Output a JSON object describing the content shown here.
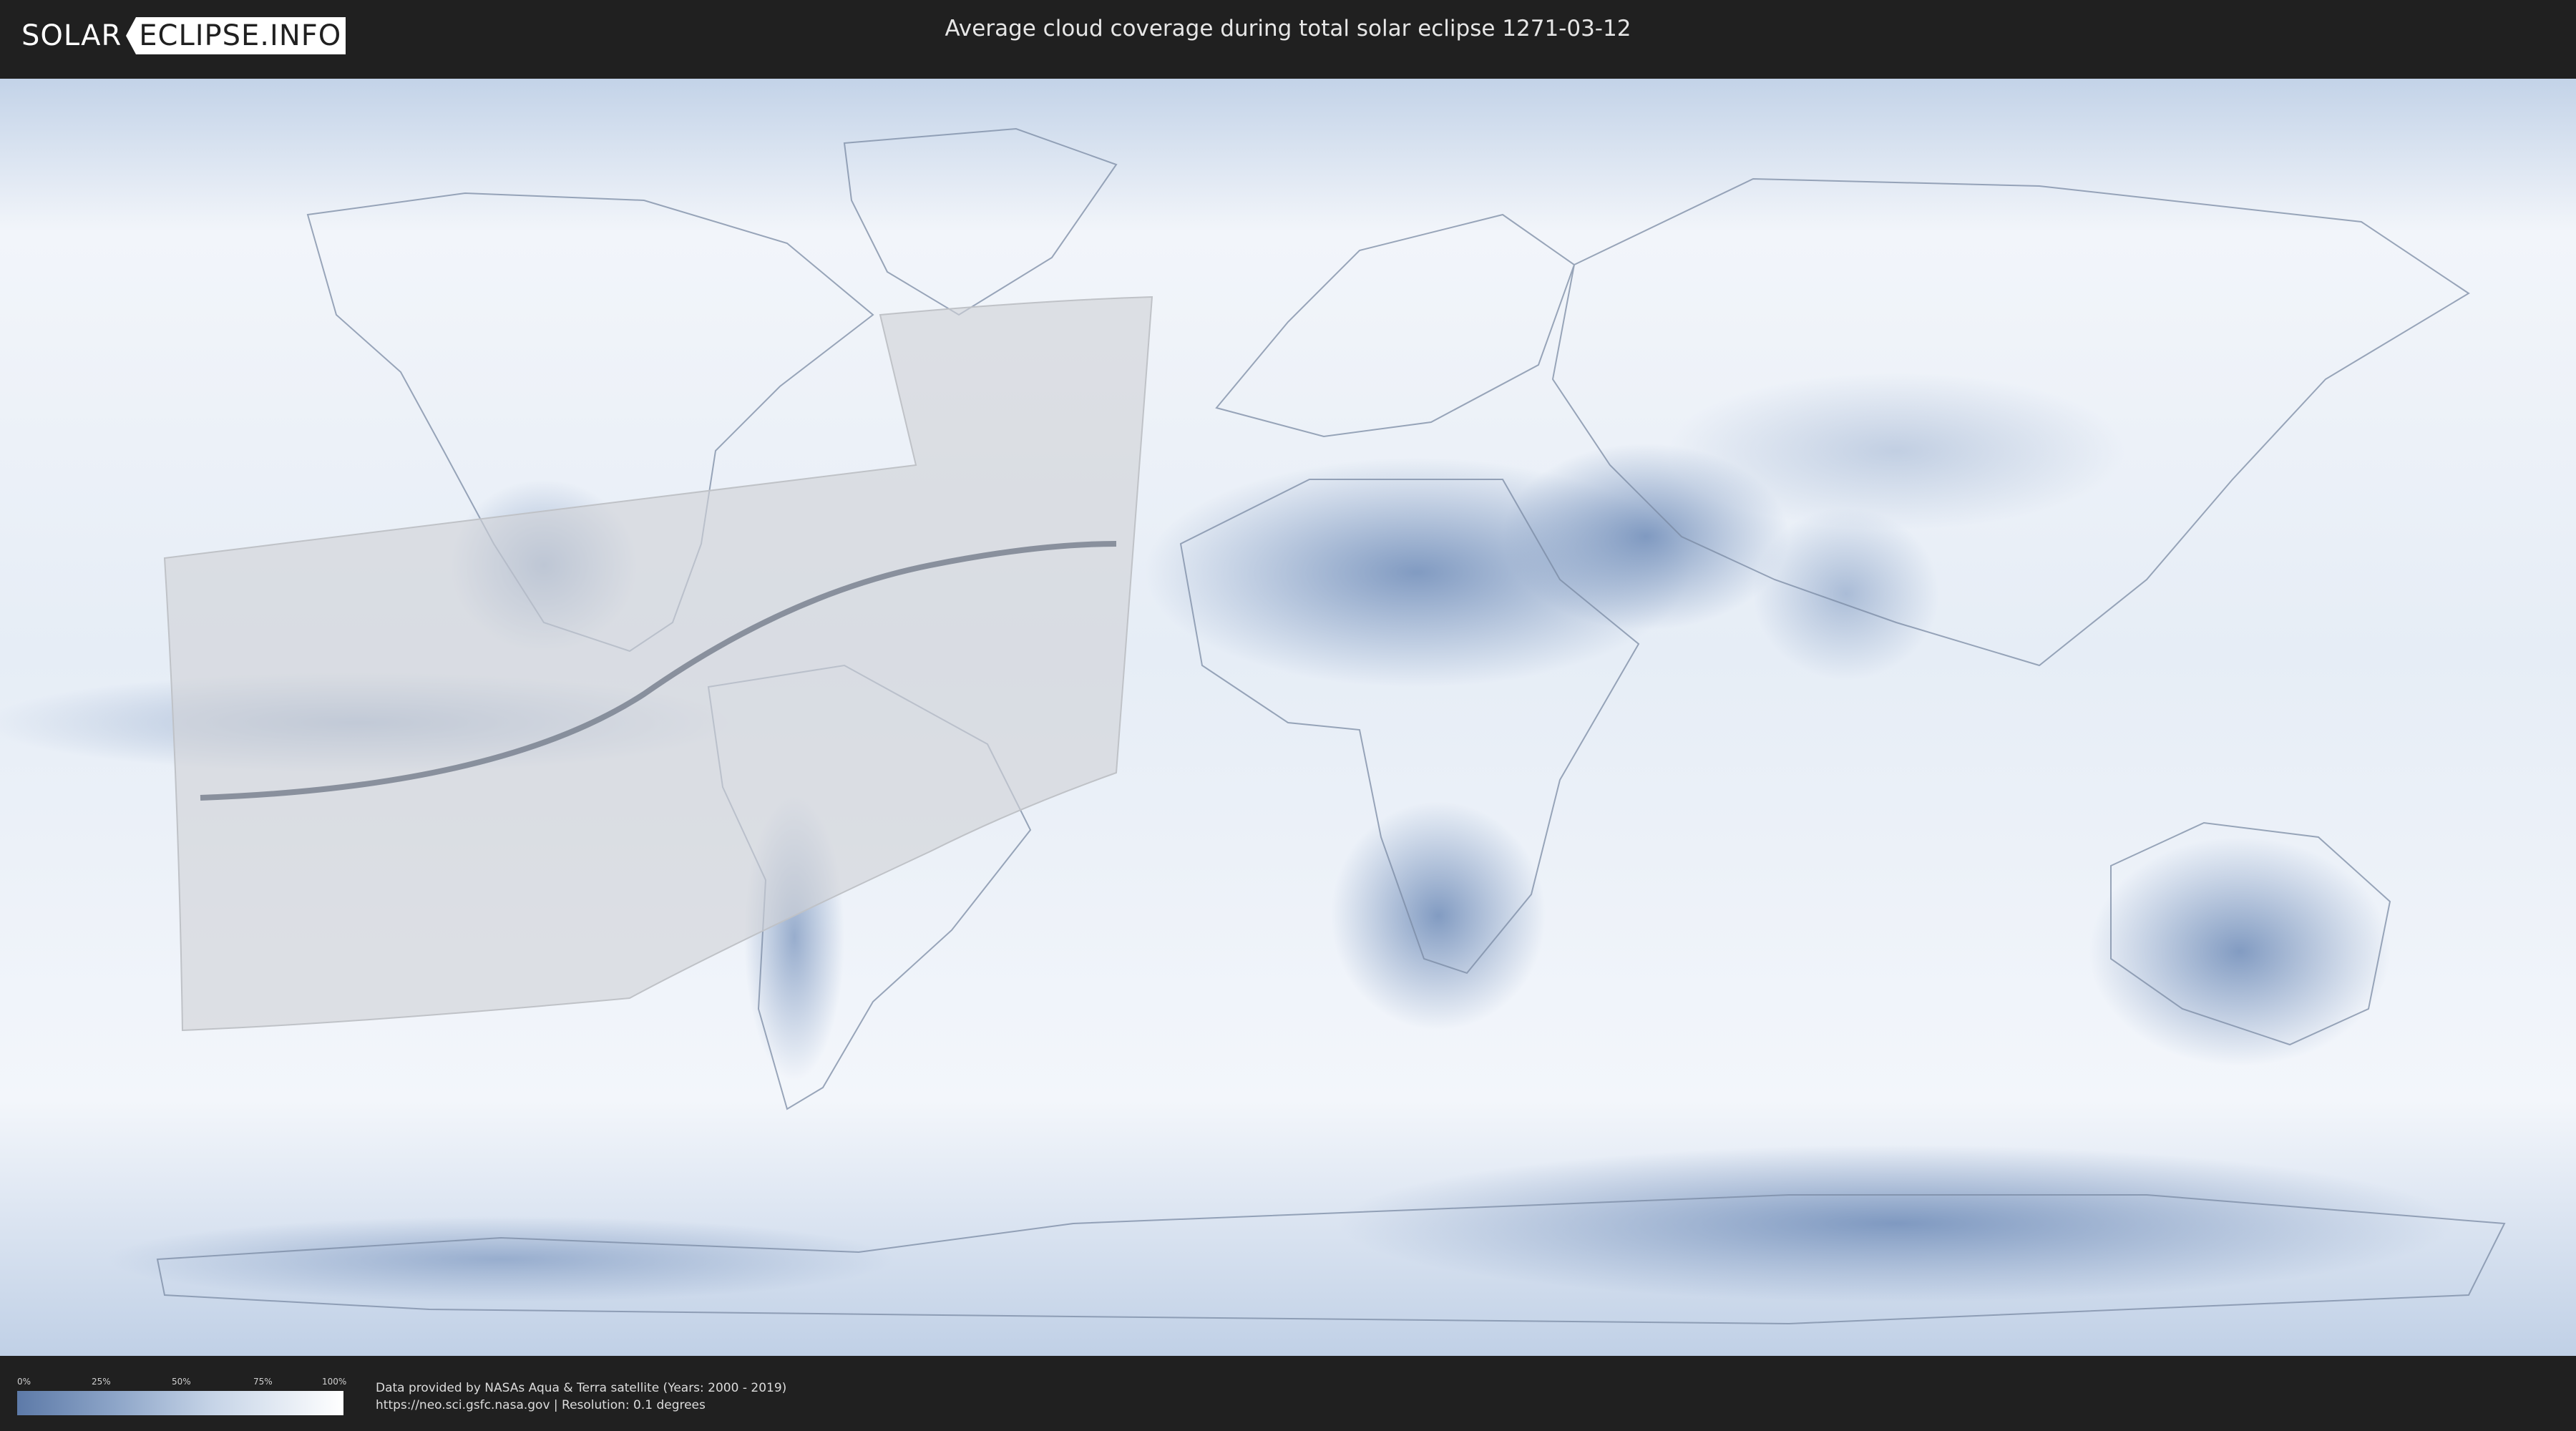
{
  "header": {
    "logo_left": "SOLAR",
    "logo_right": "ECLIPSE.INFO",
    "title": "Average cloud coverage during total solar eclipse 1271-03-12"
  },
  "legend": {
    "ticks": [
      "0%",
      "25%",
      "50%",
      "75%",
      "100%"
    ],
    "colors": {
      "min": "#5d7aa8",
      "max": "#ffffff"
    }
  },
  "footer": {
    "credit_line1": "Data provided by NASAs Aqua & Terra satellite (Years: 2000 - 2019)",
    "credit_line2": "https://neo.sci.gsfc.nasa.gov | Resolution: 0.1 degrees"
  },
  "map": {
    "type": "world cloud coverage map",
    "ocean_color": "#e9eff7",
    "cloud_low_color": "#6f8cb8",
    "path_region_color": "#d2d4d8",
    "central_line_color": "#7a8290"
  }
}
